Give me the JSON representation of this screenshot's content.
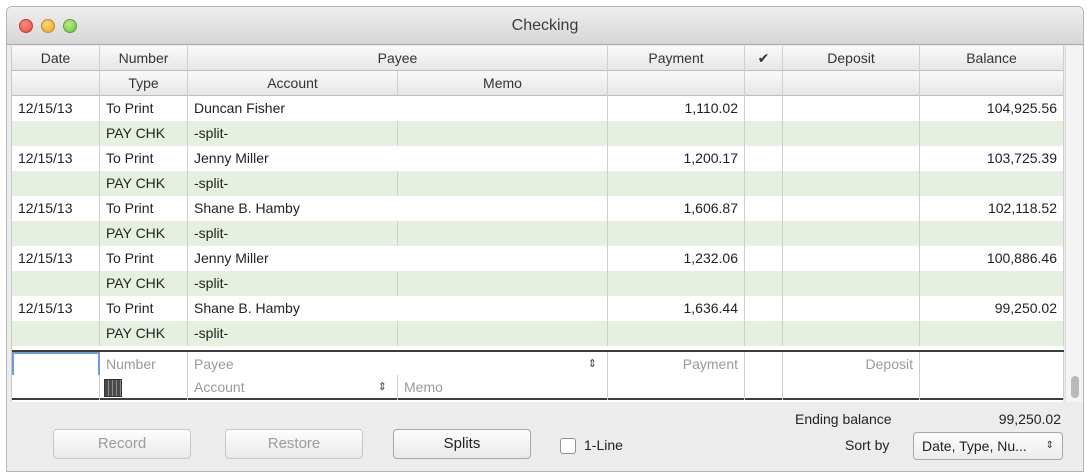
{
  "window": {
    "title": "Checking"
  },
  "header": {
    "row1": {
      "date": "Date",
      "number": "Number",
      "payee": "Payee",
      "payment": "Payment",
      "check": "✔",
      "deposit": "Deposit",
      "balance": "Balance"
    },
    "row2": {
      "type": "Type",
      "account": "Account",
      "memo": "Memo"
    }
  },
  "transactions": [
    {
      "date": "12/15/13",
      "number": "To Print",
      "payee": "Duncan Fisher",
      "payment": "1,110.02",
      "deposit": "",
      "balance": "104,925.56",
      "type": "PAY CHK",
      "account": "-split-",
      "memo": ""
    },
    {
      "date": "12/15/13",
      "number": "To Print",
      "payee": "Jenny Miller",
      "payment": "1,200.17",
      "deposit": "",
      "balance": "103,725.39",
      "type": "PAY CHK",
      "account": "-split-",
      "memo": ""
    },
    {
      "date": "12/15/13",
      "number": "To Print",
      "payee": "Shane B. Hamby",
      "payment": "1,606.87",
      "deposit": "",
      "balance": "102,118.52",
      "type": "PAY CHK",
      "account": "-split-",
      "memo": ""
    },
    {
      "date": "12/15/13",
      "number": "To Print",
      "payee": "Jenny Miller",
      "payment": "1,232.06",
      "deposit": "",
      "balance": "100,886.46",
      "type": "PAY CHK",
      "account": "-split-",
      "memo": ""
    },
    {
      "date": "12/15/13",
      "number": "To Print",
      "payee": "Shane B. Hamby",
      "payment": "1,636.44",
      "deposit": "",
      "balance": "99,250.02",
      "type": "PAY CHK",
      "account": "-split-",
      "memo": ""
    }
  ],
  "entry": {
    "date_value": "",
    "number_placeholder": "Number",
    "payee_placeholder": "Payee",
    "payment_placeholder": "Payment",
    "deposit_placeholder": "Deposit",
    "account_placeholder": "Account",
    "memo_placeholder": "Memo"
  },
  "footer": {
    "record_label": "Record",
    "restore_label": "Restore",
    "splits_label": "Splits",
    "one_line_label": "1-Line",
    "one_line_checked": false,
    "ending_balance_label": "Ending balance",
    "ending_balance_value": "99,250.02",
    "sort_by_label": "Sort by",
    "sort_by_value": "Date, Type, Nu..."
  },
  "colors": {
    "row_alt": "#e6f0e1",
    "focus": "#6c9bd6"
  },
  "icons": {
    "calendar": "calendar-icon",
    "stepper": "up-down-arrows-icon"
  }
}
